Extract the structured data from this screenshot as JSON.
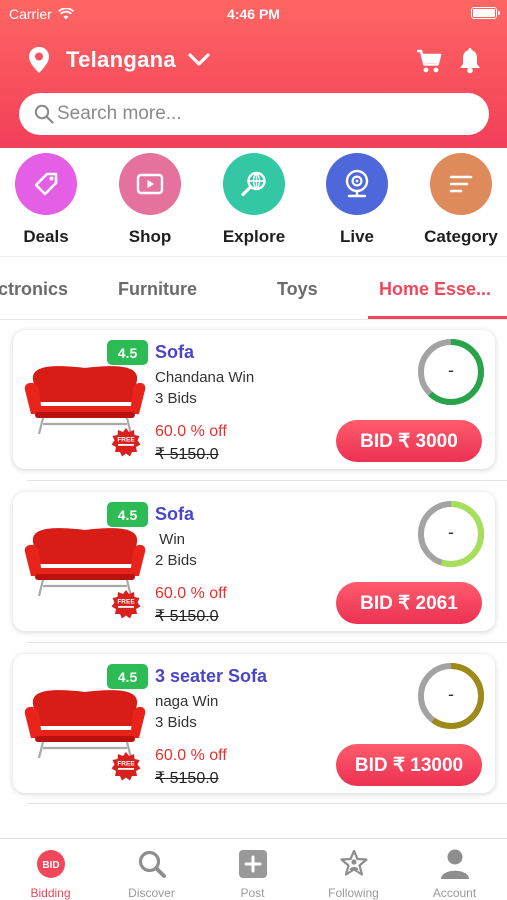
{
  "status_bar": {
    "carrier": "Carrier",
    "time": "4:46 PM"
  },
  "header": {
    "location": "Telangana",
    "search_placeholder": "Search more..."
  },
  "shortcuts": [
    {
      "label": "Deals",
      "color": "#e45ee6",
      "icon": "tag-icon"
    },
    {
      "label": "Shop",
      "color": "#e5729c",
      "icon": "play-icon"
    },
    {
      "label": "Explore",
      "color": "#33c8a3",
      "icon": "globe-search-icon"
    },
    {
      "label": "Live",
      "color": "#4e67da",
      "icon": "webcam-icon"
    },
    {
      "label": "Category",
      "color": "#df8a5a",
      "icon": "menu-lines-icon"
    }
  ],
  "tabs": [
    "ctronics",
    "Furniture",
    "Toys",
    "Home Esse..."
  ],
  "active_tab": "Home Esse...",
  "listings": [
    {
      "rating": "4.5",
      "title": "Sofa",
      "winner": "Chandana Win",
      "bids": "3 Bids",
      "discount": "60.0 % off",
      "original_price": "₹ 5150.0",
      "timer": "-",
      "timer_color": "#27a34a",
      "timer_fraction": 0.62,
      "bid_label": "BID ₹ 3000",
      "free_badge": "FREE"
    },
    {
      "rating": "4.5",
      "title": "Sofa",
      "winner": " Win",
      "bids": "2 Bids",
      "discount": "60.0 % off",
      "original_price": "₹ 5150.0",
      "timer": "-",
      "timer_color": "#a6e05a",
      "timer_fraction": 0.55,
      "bid_label": "BID ₹ 2061",
      "free_badge": "FREE"
    },
    {
      "rating": "4.5",
      "title": "3 seater Sofa",
      "winner": "naga Win",
      "bids": "3 Bids",
      "discount": "60.0 % off",
      "original_price": "₹ 5150.0",
      "timer": "-",
      "timer_color": "#9e8a16",
      "timer_fraction": 0.6,
      "bid_label": "BID ₹ 13000",
      "free_badge": "FREE"
    }
  ],
  "bottom_nav": [
    {
      "label": "Bidding",
      "icon": "bid-icon",
      "active": true
    },
    {
      "label": "Discover",
      "icon": "search-icon",
      "active": false
    },
    {
      "label": "Post",
      "icon": "plus-box-icon",
      "active": false
    },
    {
      "label": "Following",
      "icon": "star-person-icon",
      "active": false
    },
    {
      "label": "Account",
      "icon": "person-icon",
      "active": false
    }
  ],
  "colors": {
    "brand": "#f0475a",
    "rating_badge": "#2dbb55",
    "title_text": "#4b46c8",
    "discount_text": "#e8302f"
  }
}
